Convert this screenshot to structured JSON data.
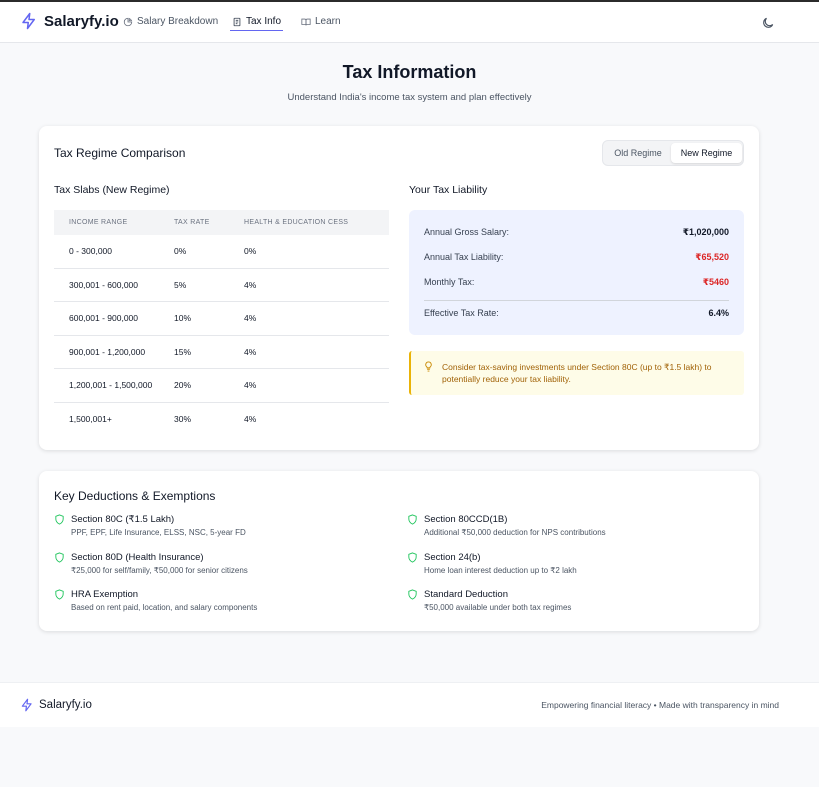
{
  "app": {
    "brand": "Salaryfy.io"
  },
  "nav": {
    "items": [
      {
        "label": "Salary Breakdown",
        "icon": "pie-chart-icon"
      },
      {
        "label": "Tax Info",
        "icon": "receipt-icon",
        "active": true
      },
      {
        "label": "Learn",
        "icon": "book-open-icon"
      }
    ],
    "theme_icon": "moon-icon"
  },
  "page": {
    "title": "Tax Information",
    "subtitle": "Understand India's income tax system and plan effectively"
  },
  "regime": {
    "title": "Tax Regime Comparison",
    "toggle": {
      "options": [
        "Old Regime",
        "New Regime"
      ],
      "selected": "New Regime"
    },
    "slabs": {
      "title": "Tax Slabs (New Regime)",
      "headers": [
        "INCOME RANGE",
        "TAX RATE",
        "HEALTH & EDUCATION CESS"
      ],
      "rows": [
        [
          "0 - 300,000",
          "0%",
          "0%"
        ],
        [
          "300,001 - 600,000",
          "5%",
          "4%"
        ],
        [
          "600,001 - 900,000",
          "10%",
          "4%"
        ],
        [
          "900,001 - 1,200,000",
          "15%",
          "4%"
        ],
        [
          "1,200,001 - 1,500,000",
          "20%",
          "4%"
        ],
        [
          "1,500,001+",
          "30%",
          "4%"
        ]
      ]
    },
    "liability": {
      "title": "Your Tax Liability",
      "gross_label": "Annual Gross Salary:",
      "gross_value": "₹1,020,000",
      "tax_label": "Annual Tax Liability:",
      "tax_value": "₹65,520",
      "monthly_label": "Monthly Tax:",
      "monthly_value": "₹5460",
      "effective_label": "Effective Tax Rate:",
      "effective_value": "6.4%"
    },
    "tip": "Consider tax-saving investments under Section 80C (up to ₹1.5 lakh) to potentially reduce your tax liability."
  },
  "deductions": {
    "title": "Key Deductions & Exemptions",
    "items": [
      {
        "title": "Section 80C (₹1.5 Lakh)",
        "desc": "PPF, EPF, Life Insurance, ELSS, NSC, 5-year FD"
      },
      {
        "title": "Section 80CCD(1B)",
        "desc": "Additional ₹50,000 deduction for NPS contributions"
      },
      {
        "title": "Section 80D (Health Insurance)",
        "desc": "₹25,000 for self/family, ₹50,000 for senior citizens"
      },
      {
        "title": "Section 24(b)",
        "desc": "Home loan interest deduction up to ₹2 lakh"
      },
      {
        "title": "HRA Exemption",
        "desc": "Based on rent paid, location, and salary components"
      },
      {
        "title": "Standard Deduction",
        "desc": "₹50,000 available under both tax regimes"
      }
    ]
  },
  "footer": {
    "brand": "Salaryfy.io",
    "tagline": "Empowering financial literacy • Made with transparency in mind"
  },
  "colors": {
    "accent": "#6366f1",
    "danger": "#dc2626",
    "success": "#22c55e",
    "tip": "#a16207"
  }
}
